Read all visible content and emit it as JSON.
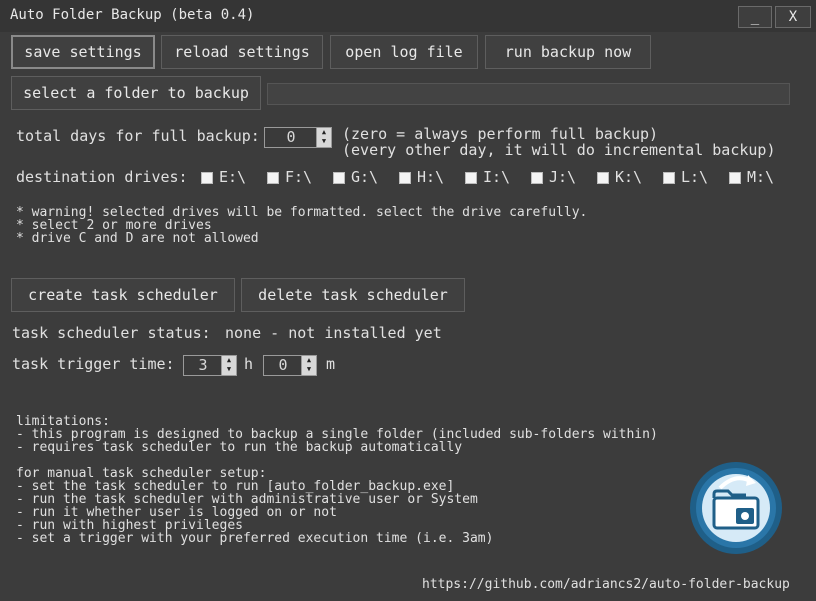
{
  "window": {
    "title": "Auto Folder Backup (beta 0.4)",
    "minimize_label": "_",
    "close_label": "X"
  },
  "toolbar": {
    "save_label": "save settings",
    "reload_label": "reload settings",
    "open_log_label": "open log file",
    "run_backup_label": "run backup now"
  },
  "folder": {
    "select_label": "select a folder to backup",
    "path_value": ""
  },
  "full_backup": {
    "label": "total days for full backup:",
    "value": "0",
    "note_line1": "(zero = always perform full backup)",
    "note_line2": "(every other day, it will do incremental backup)"
  },
  "destination": {
    "label": "destination drives:",
    "drives": [
      {
        "label": "E:\\",
        "checked": false
      },
      {
        "label": "F:\\",
        "checked": false
      },
      {
        "label": "G:\\",
        "checked": false
      },
      {
        "label": "H:\\",
        "checked": false
      },
      {
        "label": "I:\\",
        "checked": false
      },
      {
        "label": "J:\\",
        "checked": false
      },
      {
        "label": "K:\\",
        "checked": false
      },
      {
        "label": "L:\\",
        "checked": false
      },
      {
        "label": "M:\\",
        "checked": false
      }
    ]
  },
  "warnings": [
    "* warning! selected drives will be formatted. select the drive carefully.",
    "* select 2 or more drives",
    "* drive C and D are not allowed"
  ],
  "scheduler": {
    "create_label": "create task scheduler",
    "delete_label": "delete task scheduler",
    "status_label": "task scheduler status:",
    "status_value": "none - not installed yet",
    "trigger_label": "task trigger time:",
    "hour_value": "3",
    "hour_unit": "h",
    "minute_value": "0",
    "minute_unit": "m"
  },
  "info": [
    "limitations:",
    "- this program is designed to backup a single folder (included sub-folders within)",
    "- requires task scheduler to run the backup automatically",
    "",
    "for manual task scheduler setup:",
    "- set the task scheduler to run [auto_folder_backup.exe]",
    "- run the task scheduler with administrative user or System",
    "- run it whether user is logged on or not",
    "- run with highest privileges",
    "- set a trigger with your preferred execution time (i.e. 3am)"
  ],
  "footer": {
    "url": "https://github.com/adriancs2/auto-folder-backup"
  },
  "colors": {
    "background": "#3c3c3c",
    "text": "#e0e0e0",
    "logo_ring": "#1f5f88",
    "logo_inner": "#d6eaf7"
  },
  "logo": {
    "icon": "folder-sync-logo-icon"
  }
}
